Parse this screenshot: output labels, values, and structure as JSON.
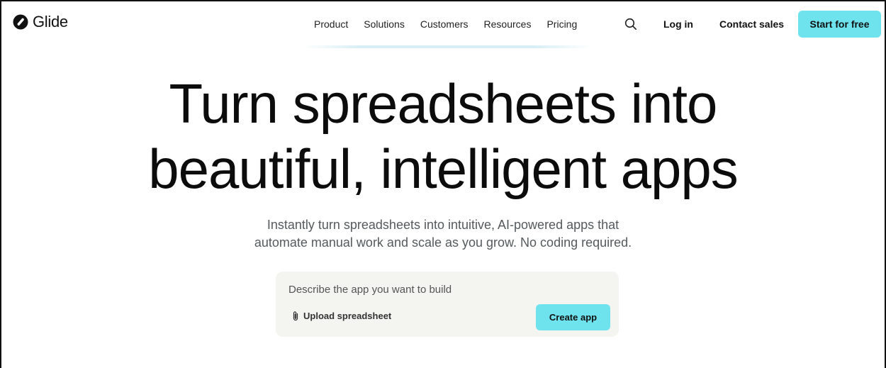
{
  "brand": {
    "name": "Glide",
    "logo_icon": "glide-logo-icon"
  },
  "nav": {
    "links": [
      "Product",
      "Solutions",
      "Customers",
      "Resources",
      "Pricing"
    ],
    "search_icon": "search-icon",
    "login_label": "Log in",
    "contact_label": "Contact sales",
    "start_label": "Start for free"
  },
  "hero": {
    "title_line1": "Turn spreadsheets into",
    "title_line2": "beautiful, intelligent apps",
    "subtitle_line1": "Instantly turn spreadsheets into intuitive, AI-powered apps that",
    "subtitle_line2": "automate manual work and scale as you grow. No coding required."
  },
  "prompt": {
    "placeholder": "Describe the app you want to build",
    "value": "",
    "upload_label": "Upload spreadsheet",
    "upload_icon": "paperclip-icon",
    "create_label": "Create app"
  },
  "colors": {
    "accent": "#6ee3ee",
    "prompt_bg": "#f4f4f1",
    "text": "#0c0c0c",
    "muted": "#555a5d"
  }
}
